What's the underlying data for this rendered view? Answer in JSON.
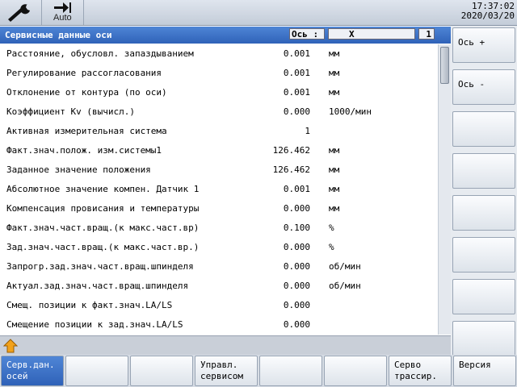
{
  "toolbar": {
    "wrench_icon": "wrench-icon",
    "auto_label": "Auto",
    "auto_icon": "arrow-right-bar-icon"
  },
  "clock": {
    "time": "17:37:02",
    "date": "2020/03/20"
  },
  "header": {
    "title": "Сервисные данные оси",
    "axis_label": "Ось :",
    "axis_value": "X",
    "axis_number": "1"
  },
  "rows": [
    {
      "label": "Расстояние, обусловл. запаздыванием",
      "value": "0.001",
      "unit": "мм"
    },
    {
      "label": "Регулирование рассогласования",
      "value": "0.001",
      "unit": "мм"
    },
    {
      "label": "Отклонение от контура (по оси)",
      "value": "0.001",
      "unit": "мм"
    },
    {
      "label": "Коэффициент Kv (вычисл.)",
      "value": "0.000",
      "unit": "1000/мин"
    },
    {
      "label": "Активная измерительная система",
      "value": "1",
      "unit": ""
    },
    {
      "label": "Факт.знач.полож. изм.системы1",
      "value": "126.462",
      "unit": "мм"
    },
    {
      "label": "Заданное значение положения",
      "value": "126.462",
      "unit": "мм"
    },
    {
      "label": "Абсолютное значение компен. Датчик 1",
      "value": "0.001",
      "unit": "мм"
    },
    {
      "label": "Компенсация провисания и температуры",
      "value": "0.000",
      "unit": "мм"
    },
    {
      "label": "Факт.знач.част.вращ.(к макс.част.вр)",
      "value": "0.100",
      "unit": "%"
    },
    {
      "label": "Зад.знач.част.вращ.(к макс.част.вр.)",
      "value": "0.000",
      "unit": "%"
    },
    {
      "label": "Запрогр.зад.знач.част.вращ.шпинделя",
      "value": "0.000",
      "unit": "об/мин"
    },
    {
      "label": "Актуал.зад.знач.част.вращ.шпинделя",
      "value": "0.000",
      "unit": "об/мин"
    },
    {
      "label": "Смещ. позиции к факт.знач.LA/LS",
      "value": "0.000",
      "unit": ""
    },
    {
      "label": "Смещение позиции к зад.знач.LA/LS",
      "value": "0.000",
      "unit": ""
    }
  ],
  "vertical_softkeys": [
    "Ось +",
    "Ось -",
    "",
    "",
    "",
    "",
    "",
    ""
  ],
  "horizontal_softkeys": [
    "Серв.дан.\nосей",
    "",
    "",
    "Управл.\nсервисом",
    "",
    "",
    "Серво\nтрассир.",
    "Версия"
  ],
  "colors": {
    "header_blue": "#2f62b8",
    "active_key_blue": "#3a6fc4",
    "panel_grey": "#c9cfd8"
  }
}
